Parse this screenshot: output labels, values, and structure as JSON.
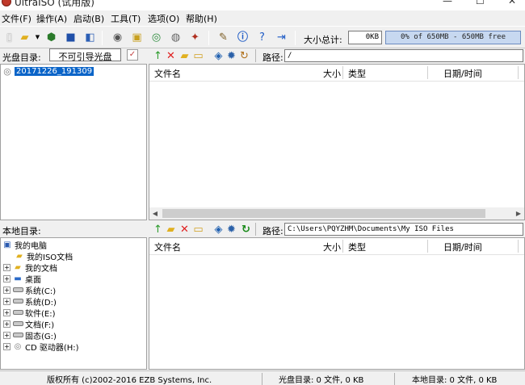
{
  "window": {
    "title": "UltraISO (试用版)",
    "controls": [
      "—",
      "☐",
      "✕"
    ]
  },
  "menu": {
    "items": [
      "文件(F)",
      "操作(A)",
      "启动(B)",
      "工具(T)",
      "选项(O)",
      "帮助(H)"
    ]
  },
  "toolbar": {
    "size_label": "大小总计:",
    "size_value": "0KB",
    "capacity_text": "0% of 650MB - 650MB free"
  },
  "disc_pane": {
    "label": "光盘目录:",
    "boot_type": "不可引导光盘",
    "tree_root": "20171226_191309",
    "path_label": "路径:",
    "path_value": "/",
    "columns": [
      "文件名",
      "大小",
      "类型",
      "日期/时间"
    ]
  },
  "local_pane": {
    "label": "本地目录:",
    "path_label": "路径:",
    "path_value": "C:\\Users\\PQYZHM\\Documents\\My ISO Files",
    "columns": [
      "文件名",
      "大小",
      "类型",
      "日期/时间"
    ],
    "tree": [
      {
        "label": "我的电脑",
        "icon": "computer-icon"
      },
      {
        "label": "我的ISO文档",
        "icon": "folder-icon"
      },
      {
        "label": "我的文档",
        "icon": "folder-icon"
      },
      {
        "label": "桌面",
        "icon": "desktop-icon"
      },
      {
        "label": "系统(C:)",
        "icon": "drive-icon"
      },
      {
        "label": "系统(D:)",
        "icon": "drive-icon"
      },
      {
        "label": "软件(E:)",
        "icon": "drive-icon"
      },
      {
        "label": "文档(F:)",
        "icon": "drive-icon"
      },
      {
        "label": "固态(G:)",
        "icon": "drive-icon"
      },
      {
        "label": "CD 驱动器(H:)",
        "icon": "cd-drive-icon"
      }
    ]
  },
  "status": {
    "copyright": "版权所有 (c)2002-2016 EZB Systems, Inc.",
    "disc_summary": "光盘目录: 0 文件, 0 KB",
    "local_summary": "本地目录: 0 文件, 0 KB"
  },
  "colors": {
    "selection": "#0a64c8",
    "progress_fill": "#c7d8f0"
  }
}
